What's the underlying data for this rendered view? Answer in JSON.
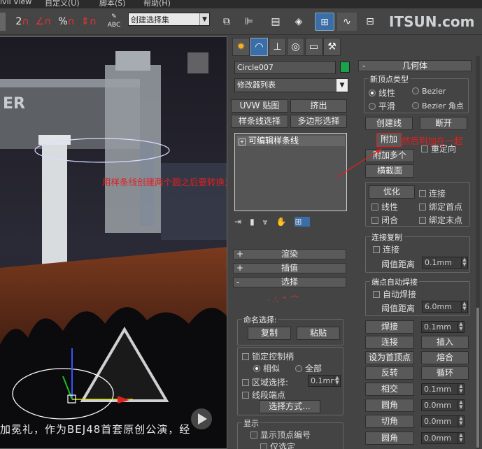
{
  "menu": {
    "items": [
      "ivil View",
      "自定义(U)",
      "脚本(S)",
      "帮助(H)"
    ]
  },
  "toolbar": {
    "selection_set": "创建选择集",
    "snap_icons": [
      "2",
      "%",
      "ABC"
    ]
  },
  "watermark": "ITSUN.com",
  "viewport": {
    "subtitle": "加冕礼，作为BEJ48首套原创公演，经",
    "stage_text": "ER"
  },
  "annotation": {
    "main": "用样条线创建两个圆之后要转换为可编辑样条线",
    "attach": "然后附加在一起",
    "color": "#e02020"
  },
  "modify": {
    "object_name": "Circle007",
    "object_color": "#1aa34a",
    "modifier_list": "修改器列表",
    "buttons": [
      "UVW 贴图",
      "挤出",
      "样条线选择",
      "多边形选择"
    ],
    "stack_item": "可编辑样条线",
    "rollups": [
      {
        "sign": "+",
        "title": "渲染"
      },
      {
        "sign": "+",
        "title": "插值"
      },
      {
        "sign": "-",
        "title": "选择"
      }
    ],
    "named_sel": {
      "label": "命名选择:",
      "copy": "复制",
      "paste": "粘贴"
    },
    "lock_handles": "锁定控制柄",
    "similar": "相似",
    "all": "全部",
    "area_sel": "区域选择:",
    "area_val": "0.1mm",
    "segment_end": "线段端点",
    "select_by": "选择方式...",
    "display": "显示",
    "show_vertex_num": "显示顶点编号",
    "only_selected": "仅选定"
  },
  "geometry": {
    "title": "几何体",
    "new_vertex_type": "新顶点类型",
    "linear": "线性",
    "bezier": "Bezier",
    "smooth": "平滑",
    "bezier_corner": "Bezier 角点",
    "create_line": "创建线",
    "break": "断开",
    "attach": "附加",
    "reorient": "重定向",
    "attach_multi": "附加多个",
    "cross_section": "横截面",
    "refine": "优化",
    "connect": "连接",
    "linear2": "线性",
    "bind_first": "绑定首点",
    "closed": "闭合",
    "bind_last": "绑定末点",
    "connect_copy": "连接复制",
    "connect2": "连接",
    "threshold": "阈值距离",
    "threshold_val": "0.1mm",
    "end_weld": "端点自动焊接",
    "auto_weld": "自动焊接",
    "weld_dist": "阈值距离",
    "weld_val": "6.0mm",
    "weld": "焊接",
    "weld_v": "0.1mm",
    "connect3": "连接",
    "insert": "插入",
    "make_first": "设为首顶点",
    "fuse": "熔合",
    "reverse": "反转",
    "cycle": "循环",
    "cross_insert": "相交",
    "cross_v": "0.1mm",
    "fillet": "圆角",
    "fillet_v": "0.0mm",
    "chamfer": "切角",
    "chamfer_v": "0.0mm",
    "fillet2": "圆角",
    "fillet2_v": "0.0mm"
  }
}
